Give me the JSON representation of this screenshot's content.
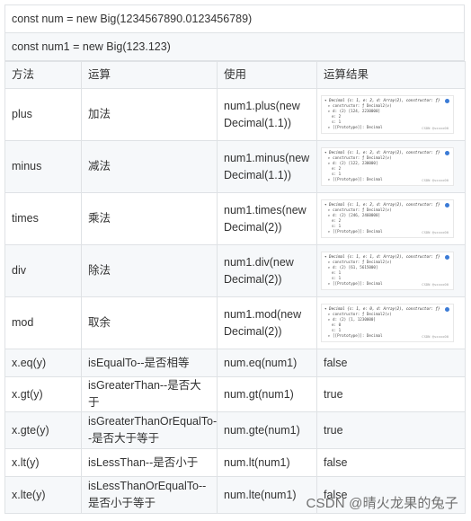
{
  "code": {
    "line1": "const num = new Big(1234567890.0123456789)",
    "line2": "const num1 = new Big(123.123)"
  },
  "table": {
    "headers": [
      "方法",
      "运算",
      "使用",
      "运算结果"
    ],
    "rows": [
      {
        "method": "plus",
        "op": "加法",
        "usage": "num1.plus(new Decimal(1.1))",
        "result": ""
      },
      {
        "method": "minus",
        "op": "减法",
        "usage": "num1.minus(new Decimal(1.1))",
        "result": ""
      },
      {
        "method": "times",
        "op": "乘法",
        "usage": "num1.times(new Decimal(2))",
        "result": ""
      },
      {
        "method": "div",
        "op": "除法",
        "usage": "num1.div(new Decimal(2))",
        "result": ""
      },
      {
        "method": "mod",
        "op": "取余",
        "usage": "num1.mod(new Decimal(2))",
        "result": ""
      },
      {
        "method": "x.eq(y)",
        "op": "isEqualTo--是否相等",
        "usage": "num.eq(num1)",
        "result": "false"
      },
      {
        "method": "x.gt(y)",
        "op": "isGreaterThan--是否大于",
        "usage": "num.gt(num1)",
        "result": "true"
      },
      {
        "method": "x.gte(y)",
        "op": "isGreaterThanOrEqualTo--是否大于等于",
        "usage": "num.gte(num1)",
        "result": "true"
      },
      {
        "method": "x.lt(y)",
        "op": "isLessThan--是否小于",
        "usage": "num.lt(num1)",
        "result": "false"
      },
      {
        "method": "x.lte(y)",
        "op": "isLessThanOrEqualTo--是否小于等于",
        "usage": "num.lte(num1)",
        "result": "false"
      }
    ]
  },
  "thumbnails": [
    {
      "head": "Decimal {s: 1, e: 2, d: Array(2), constructor: ƒ}",
      "lines": [
        "▸ constructor: ƒ Decimal2(v)",
        "▸ d: (2) [124, 2230000]",
        "e: 2",
        "s: 1",
        "▸ [[Prototype]]: Decimal"
      ],
      "watermark": "CSDN @sxxxx00"
    },
    {
      "head": "Decimal {s: 1, e: 2, d: Array(2), constructor: ƒ}",
      "lines": [
        "▸ constructor: ƒ Decimal2(v)",
        "▸ d: (2) [122, 230000]",
        "e: 2",
        "s: 1",
        "▸ [[Prototype]]: Decimal"
      ],
      "watermark": "CSDN @sxxxx00"
    },
    {
      "head": "Decimal {s: 1, e: 2, d: Array(2), constructor: ƒ}",
      "lines": [
        "▸ constructor: ƒ Decimal2(v)",
        "▸ d: (2) [246, 2460000]",
        "e: 2",
        "s: 1",
        "▸ [[Prototype]]: Decimal"
      ],
      "watermark": "CSDN @sxxxx00"
    },
    {
      "head": "Decimal {s: 1, e: 1, d: Array(2), constructor: ƒ}",
      "lines": [
        "▸ constructor: ƒ Decimal2(v)",
        "▸ d: (2) [61, 5615000]",
        "e: 1",
        "s: 1",
        "▸ [[Prototype]]: Decimal"
      ],
      "watermark": "CSDN @sxxxx00"
    },
    {
      "head": "Decimal {s: 1, e: 0, d: Array(2), constructor: ƒ}",
      "lines": [
        "▸ constructor: ƒ Decimal2(v)",
        "▸ d: (2) [1, 1230000]",
        "e: 0",
        "s: 1",
        "▸ [[Prototype]]: Decimal"
      ],
      "watermark": "CSDN @sxxxx00"
    }
  ],
  "watermark": "CSDN @晴火龙果的兔子"
}
